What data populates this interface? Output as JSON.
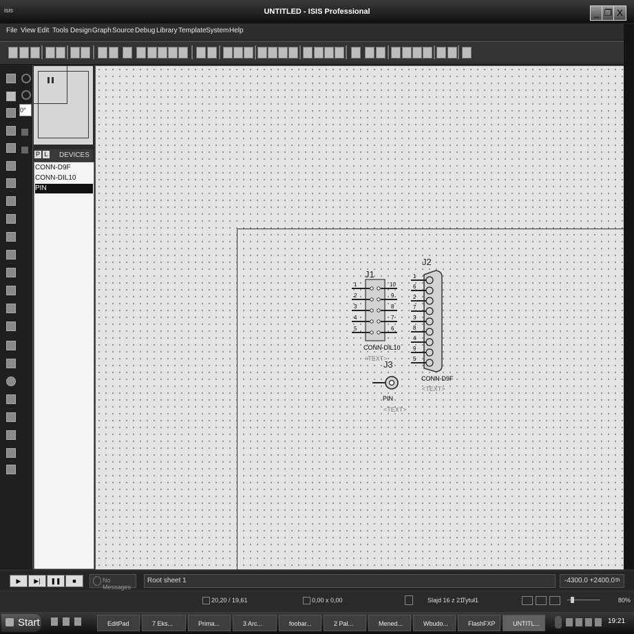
{
  "window": {
    "app_tag": "isis",
    "title": "UNTITLED - ISIS Professional",
    "minimize": "_",
    "maximize": "❐",
    "close": "X"
  },
  "menu": [
    "File",
    "View",
    "Edit",
    "Tools",
    "Design",
    "Graph",
    "Source",
    "Debug",
    "Library",
    "Template",
    "System",
    "Help"
  ],
  "rotation_field": "0°",
  "devices_panel": {
    "tab_p": "P",
    "tab_l": "L",
    "label": "DEVICES",
    "items": [
      "CONN-D9F",
      "CONN-DIL10",
      "PIN"
    ],
    "selected": "PIN"
  },
  "schematic": {
    "j1": {
      "ref": "J1",
      "part": "CONN-DIL10",
      "text": "<TEXT>",
      "left_pins": [
        "1",
        "2",
        "3",
        "4",
        "5"
      ],
      "right_pins": [
        "10",
        "9",
        "8",
        "7",
        "6"
      ]
    },
    "j2": {
      "ref": "J2",
      "part": "CONN-D9F",
      "text": "<TEXT>",
      "pins": [
        "1",
        "6",
        "2",
        "7",
        "3",
        "8",
        "4",
        "9",
        "5"
      ]
    },
    "j3": {
      "ref": "J3",
      "part": "PIN",
      "text": "<TEXT>"
    }
  },
  "status": {
    "messages": "No Messages",
    "sheet": "Root sheet 1",
    "coords": "-4300.0   +2400.0",
    "unit": "th"
  },
  "office_status": {
    "position": "20,20 / 19,61",
    "size": "0,00 x 0,00",
    "slide": "Slajd 16 z 21",
    "layout": "Tytuł1",
    "zoom": "80%"
  },
  "taskbar": {
    "start": "Start",
    "tasks": [
      "EditPad",
      "7 Eks...",
      "Prima...",
      "3 Arc...",
      "foobar...",
      "2 Pal...",
      "Mened...",
      "Wbudo...",
      "FlashFXP",
      "UNTITL..."
    ],
    "clock": "19:21"
  }
}
